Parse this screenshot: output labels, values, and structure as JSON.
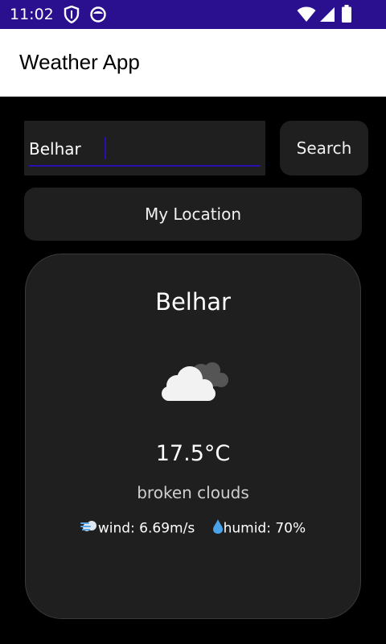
{
  "status_bar": {
    "time": "11:02",
    "icons": [
      "shield-icon",
      "face-icon",
      "wifi-icon",
      "signal-icon",
      "battery-icon"
    ],
    "color": "#2a0f8f"
  },
  "app_bar": {
    "title": "Weather App"
  },
  "search": {
    "value": "Belhar",
    "button_label": "Search",
    "accent": "#2a0fb0"
  },
  "location_button": {
    "label": "My Location"
  },
  "weather": {
    "city": "Belhar",
    "condition_icon": "cloud-icon",
    "temperature": "17.5°C",
    "description": "broken clouds",
    "wind_icon": "wind-icon",
    "wind": "wind: 6.69m/s",
    "humidity_icon": "droplet-icon",
    "humidity": "humid: 70%"
  },
  "colors": {
    "background": "#000000",
    "surface": "#1f1f1f",
    "app_bar": "#ffffff"
  }
}
